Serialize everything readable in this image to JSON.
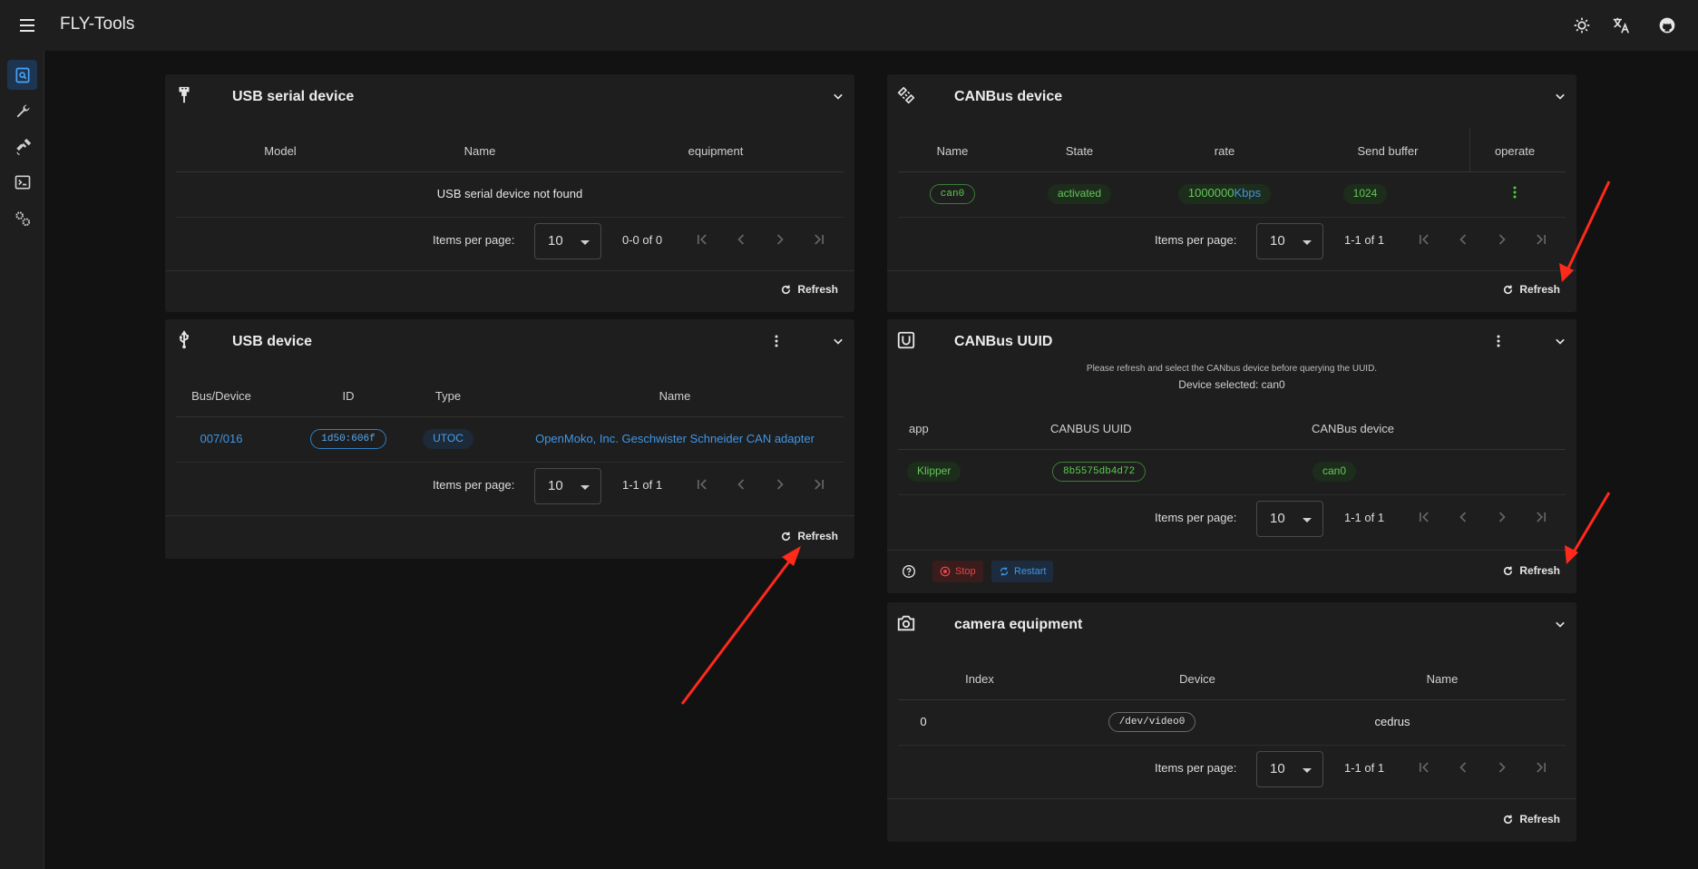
{
  "app": {
    "title": "FLY-Tools"
  },
  "usb_serial": {
    "title": "USB serial device",
    "columns": [
      "Model",
      "Name",
      "equipment"
    ],
    "empty_text": "USB serial device not found",
    "pager": {
      "label": "Items per page:",
      "per_page": "10",
      "range": "0-0 of 0"
    },
    "refresh": "Refresh"
  },
  "usb_device": {
    "title": "USB device",
    "columns": [
      "Bus/Device",
      "ID",
      "Type",
      "Name"
    ],
    "rows": [
      {
        "bus": "007/016",
        "id": "1d50:606f",
        "type": "UTOC",
        "name": "OpenMoko, Inc. Geschwister Schneider CAN adapter"
      }
    ],
    "pager": {
      "label": "Items per page:",
      "per_page": "10",
      "range": "1-1 of 1"
    },
    "refresh": "Refresh"
  },
  "canbus_device": {
    "title": "CANBus device",
    "columns": [
      "Name",
      "State",
      "rate",
      "Send buffer",
      "operate"
    ],
    "rows": [
      {
        "name": "can0",
        "state": "activated",
        "rate_value": "1000000",
        "rate_unit": "Kbps",
        "buffer": "1024"
      }
    ],
    "pager": {
      "label": "Items per page:",
      "per_page": "10",
      "range": "1-1 of 1"
    },
    "refresh": "Refresh"
  },
  "canbus_uuid": {
    "title": "CANBus UUID",
    "hint": "Please refresh and select the CANbus device before querying the UUID.",
    "selected": "Device selected: can0",
    "columns": [
      "app",
      "CANBUS UUID",
      "CANBus device"
    ],
    "rows": [
      {
        "app": "Klipper",
        "uuid": "8b5575db4d72",
        "device": "can0"
      }
    ],
    "pager": {
      "label": "Items per page:",
      "per_page": "10",
      "range": "1-1 of 1"
    },
    "stop": "Stop",
    "restart": "Restart",
    "refresh": "Refresh"
  },
  "camera": {
    "title": "camera equipment",
    "columns": [
      "Index",
      "Device",
      "Name"
    ],
    "rows": [
      {
        "index": "0",
        "device": "/dev/video0",
        "name": "cedrus"
      }
    ],
    "pager": {
      "label": "Items per page:",
      "per_page": "10",
      "range": "1-1 of 1"
    },
    "refresh": "Refresh"
  },
  "colors": {
    "accent": "#3f96e6",
    "success": "#5ccf4e",
    "danger": "#e84545",
    "arrow": "#ff2a1a"
  },
  "icons": [
    "menu-icon",
    "brightness-icon",
    "translate-icon",
    "github-icon",
    "device-search-icon",
    "wrench-icon",
    "satellite-icon",
    "terminal-icon",
    "settings-icon"
  ]
}
